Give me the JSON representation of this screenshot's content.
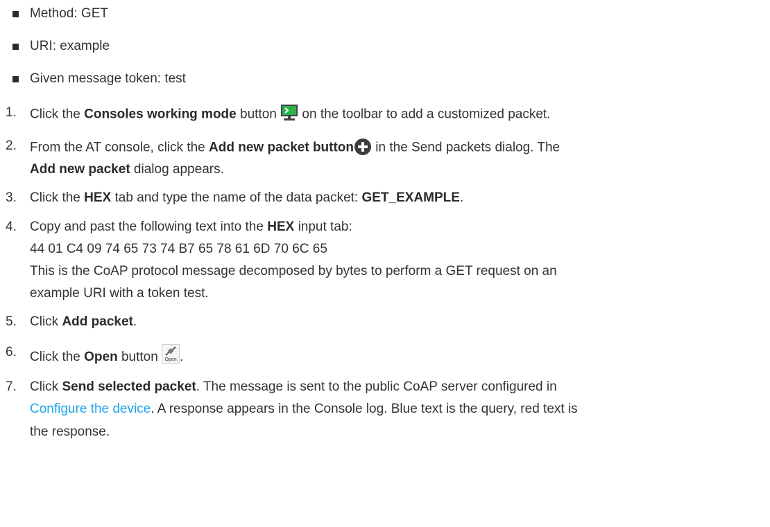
{
  "bullets": [
    "Method: GET",
    "URI: example",
    "Given message token: test"
  ],
  "steps": {
    "s1": {
      "num": "1.",
      "pre": "Click the ",
      "bold": "Consoles working mode",
      "mid": " button ",
      "post": " on the toolbar to add a customized packet.",
      "icon": "console-monitor-icon"
    },
    "s2": {
      "num": "2.",
      "pre": "From the AT console, click the ",
      "bold": "Add new packet button",
      "post": " in the Send packets dialog. The",
      "line2_bold": "Add new packet",
      "line2_post": " dialog appears.",
      "icon": "add-circle-icon"
    },
    "s3": {
      "num": "3.",
      "pre": "Click the ",
      "bold": "HEX",
      "mid": " tab and type the name of the data packet: ",
      "bold2": "GET_EXAMPLE",
      "post": "."
    },
    "s4": {
      "num": "4.",
      "pre": "Copy and past the following text into the ",
      "bold": "HEX",
      "post": " input tab:",
      "hex": "44 01 C4 09 74 65 73 74 B7 65 78 61 6D 70 6C 65",
      "desc1": "This is the CoAP protocol message decomposed by bytes to perform a GET request on an",
      "desc2": "example URI with a token test."
    },
    "s5": {
      "num": "5.",
      "pre": "Click ",
      "bold": "Add packet",
      "post": "."
    },
    "s6": {
      "num": "6.",
      "pre": "Click the ",
      "bold": "Open",
      "mid": " button ",
      "post": ".",
      "icon_label": "Open",
      "icon": "open-connection-icon"
    },
    "s7": {
      "num": "7.",
      "pre": "Click ",
      "bold": "Send selected packet",
      "post": ". The message is sent to the public CoAP server configured in",
      "link": "Configure the device",
      "line2_post": ". A response appears in the Console log. Blue text is the query, red text is",
      "line3": "the response."
    }
  },
  "colors": {
    "link": "#1ca3ec",
    "text": "#333333",
    "icon_green": "#2db34a"
  }
}
